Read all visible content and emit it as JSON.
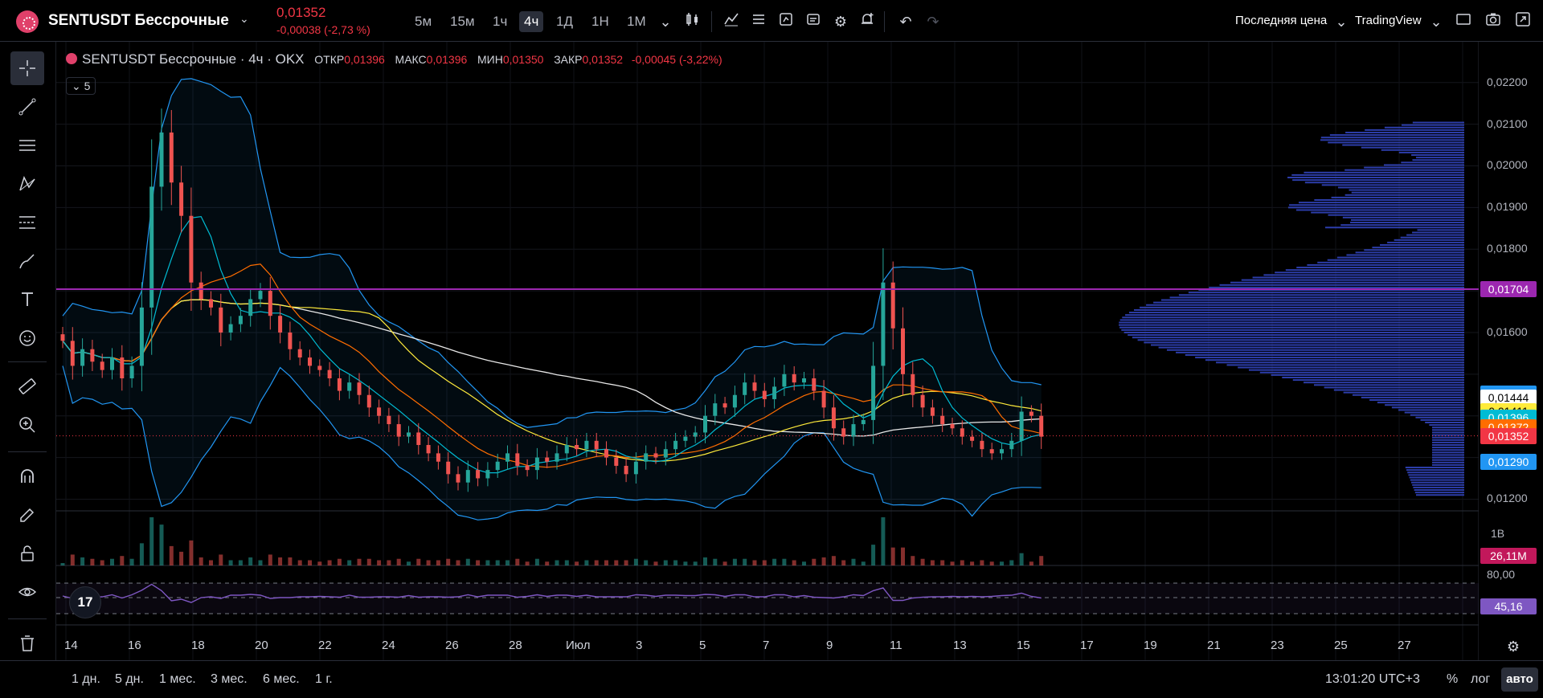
{
  "header": {
    "symbol": "SENTUSDT Бессрочные",
    "price": "0,01352",
    "change": "-0,00038 (-2,73 %)",
    "timeframes": [
      "5м",
      "15м",
      "1ч",
      "4ч",
      "1Д",
      "1Н",
      "1М"
    ],
    "active_timeframe": "4ч",
    "price_type": "Последняя цена",
    "provider": "TradingView"
  },
  "legend": {
    "title": "SENTUSDT Бессрочные · 4ч · OKX",
    "open_label": "ОТКР",
    "open": "0,01396",
    "high_label": "МАКС",
    "high": "0,01396",
    "low_label": "МИН",
    "low": "0,01350",
    "close_label": "ЗАКР",
    "close": "0,01352",
    "change": "-0,00045 (-3,22%)",
    "indicators_count": "5"
  },
  "price_scale": {
    "ticks": [
      "0,02200",
      "0,02100",
      "0,02000",
      "0,01900",
      "0,01800",
      "0,01600",
      "0,01200"
    ],
    "labels": [
      {
        "text": "0,01704",
        "color": "#9c27b0"
      },
      {
        "text": "0,01454",
        "color": "#2196f3"
      },
      {
        "text": "0,01444",
        "color": "#ffffff"
      },
      {
        "text": "0,01411",
        "color": "#ffeb3b"
      },
      {
        "text": "0,01396",
        "color": "#00bcd4"
      },
      {
        "text": "0,01372",
        "color": "#ff6d00"
      },
      {
        "text": "0,01352",
        "color": "#f23645"
      },
      {
        "text": "0,01290",
        "color": "#2196f3"
      }
    ]
  },
  "volume_pane": {
    "scale": "1B",
    "value": "26,11M"
  },
  "rsi_pane": {
    "level": "80,00",
    "value": "45,16"
  },
  "time_axis": [
    "14",
    "16",
    "18",
    "20",
    "22",
    "24",
    "26",
    "28",
    "Июл",
    "3",
    "5",
    "7",
    "9",
    "11",
    "13",
    "15",
    "17",
    "19",
    "21",
    "23",
    "25",
    "27"
  ],
  "bottom": {
    "ranges": [
      "1 дн.",
      "5 дн.",
      "1 мес.",
      "3 мес.",
      "6 мес.",
      "1 г."
    ],
    "clock": "13:01:20 UTC+3",
    "percent": "%",
    "log": "лог",
    "auto": "авто"
  },
  "colors": {
    "up": "#26a69a",
    "down": "#ef5350",
    "hline": "#9c27b0",
    "bb": "#2196f3"
  },
  "chart_data": {
    "type": "candlestick",
    "y_range": [
      0.0117,
      0.0224
    ],
    "hline": 0.01704,
    "closes": [
      0.0158,
      0.0152,
      0.0156,
      0.0153,
      0.0151,
      0.0154,
      0.0149,
      0.0152,
      0.0166,
      0.0195,
      0.0208,
      0.0196,
      0.0188,
      0.0172,
      0.0168,
      0.0166,
      0.016,
      0.0162,
      0.0164,
      0.0168,
      0.017,
      0.0164,
      0.016,
      0.0156,
      0.0154,
      0.0152,
      0.0151,
      0.0149,
      0.0146,
      0.0148,
      0.0145,
      0.0142,
      0.014,
      0.0138,
      0.0135,
      0.0136,
      0.0133,
      0.0131,
      0.0129,
      0.0126,
      0.0124,
      0.0127,
      0.0125,
      0.0127,
      0.0129,
      0.0131,
      0.0128,
      0.0127,
      0.013,
      0.0129,
      0.0131,
      0.0133,
      0.0132,
      0.0134,
      0.0132,
      0.013,
      0.0128,
      0.0126,
      0.0129,
      0.0131,
      0.013,
      0.0132,
      0.0134,
      0.0135,
      0.0136,
      0.014,
      0.0143,
      0.0142,
      0.0145,
      0.0148,
      0.0146,
      0.0144,
      0.0147,
      0.015,
      0.0148,
      0.0149,
      0.0146,
      0.0142,
      0.0137,
      0.0135,
      0.0138,
      0.0139,
      0.0152,
      0.0172,
      0.0161,
      0.015,
      0.0145,
      0.0142,
      0.014,
      0.0138,
      0.0137,
      0.0135,
      0.0134,
      0.0132,
      0.0131,
      0.0132,
      0.0134,
      0.0141,
      0.014,
      0.0135
    ],
    "ohlc_note": "approximate 4h closes read from the price axis"
  }
}
